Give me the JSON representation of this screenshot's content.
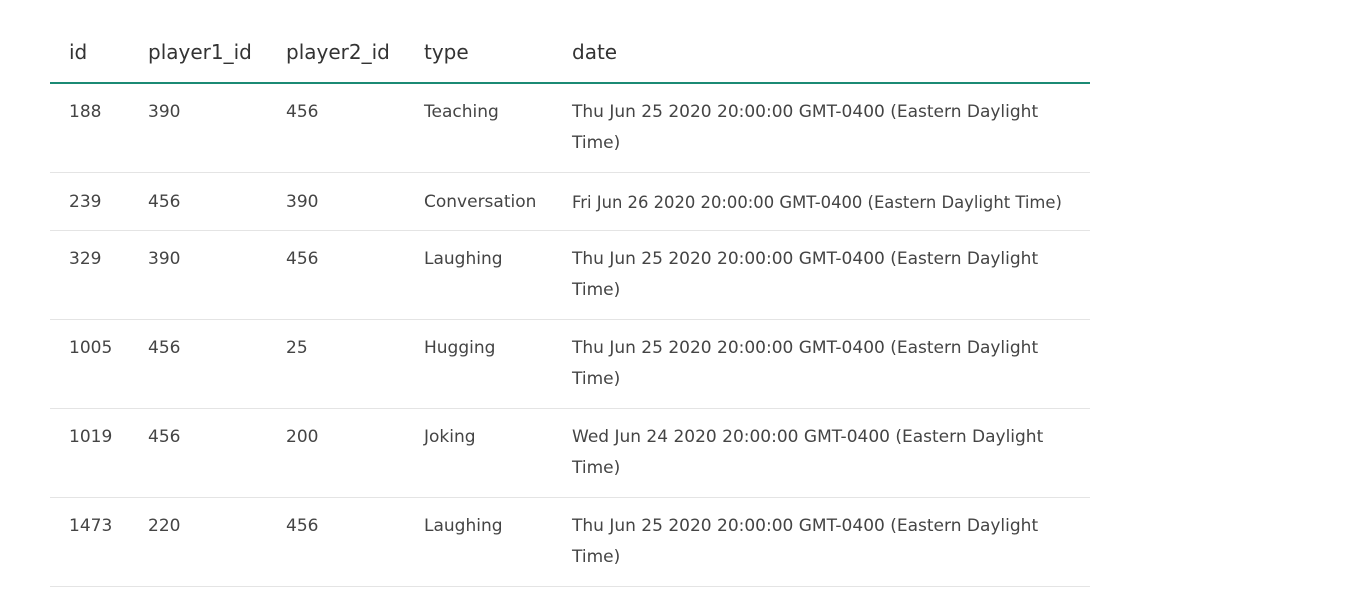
{
  "table": {
    "columns": [
      "id",
      "player1_id",
      "player2_id",
      "type",
      "date"
    ],
    "rows": [
      {
        "id": "188",
        "player1_id": "390",
        "player2_id": "456",
        "type": "Teaching",
        "date": "Thu Jun 25 2020 20:00:00 GMT-0400 (Eastern Daylight Time)"
      },
      {
        "id": "239",
        "player1_id": "456",
        "player2_id": "390",
        "type": "Conversation",
        "date": "Fri Jun 26 2020 20:00:00 GMT-0400 (Eastern Daylight Time)"
      },
      {
        "id": "329",
        "player1_id": "390",
        "player2_id": "456",
        "type": "Laughing",
        "date": "Thu Jun 25 2020 20:00:00 GMT-0400 (Eastern Daylight Time)"
      },
      {
        "id": "1005",
        "player1_id": "456",
        "player2_id": "25",
        "type": "Hugging",
        "date": "Thu Jun 25 2020 20:00:00 GMT-0400 (Eastern Daylight Time)"
      },
      {
        "id": "1019",
        "player1_id": "456",
        "player2_id": "200",
        "type": "Joking",
        "date": "Wed Jun 24 2020 20:00:00 GMT-0400 (Eastern Daylight Time)"
      },
      {
        "id": "1473",
        "player1_id": "220",
        "player2_id": "456",
        "type": "Laughing",
        "date": "Thu Jun 25 2020 20:00:00 GMT-0400 (Eastern Daylight Time)"
      }
    ]
  },
  "colors": {
    "header_rule": "#1b8a74",
    "row_rule": "#e4e4e4",
    "text": "#444444"
  }
}
